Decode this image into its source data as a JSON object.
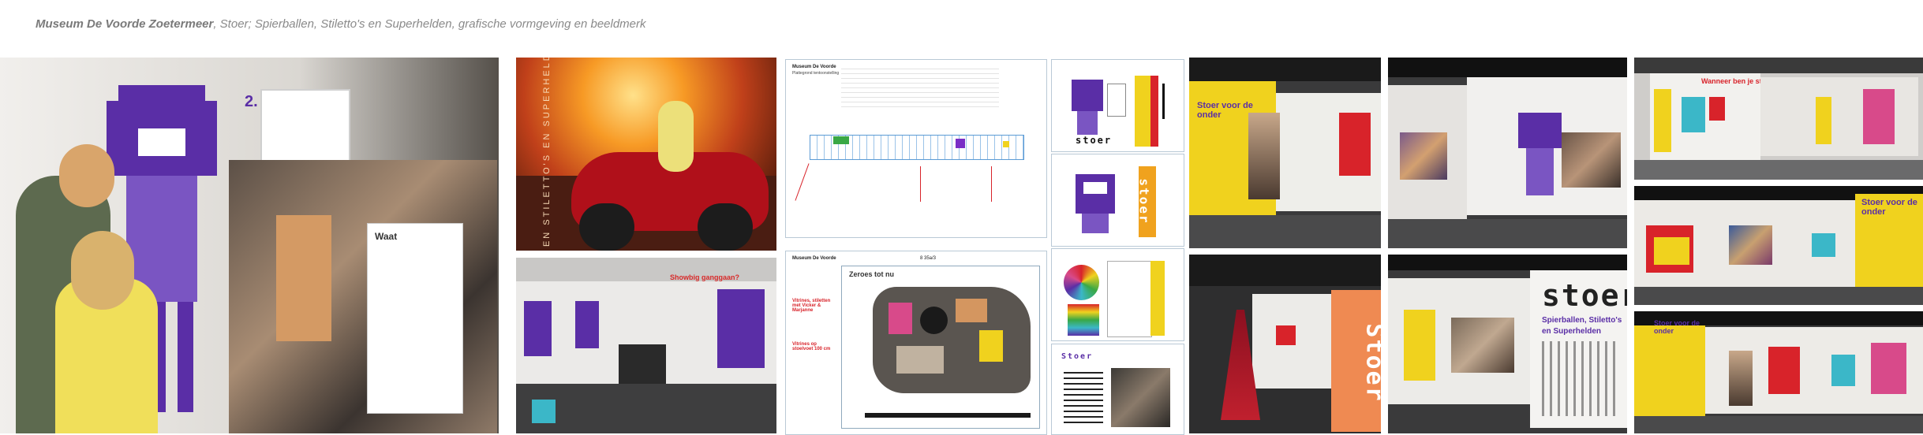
{
  "caption": {
    "museum": "Museum De Voorde Zoetermeer",
    "rest": ", Stoer; Spierballen, Stiletto's en Superhelden, grafische vormgeving en beeldmerk"
  },
  "photo1": {
    "wall_title": "Waat",
    "number": "2."
  },
  "photo2": {
    "vertical_text": "EN STILETTO'S EN SUPERHELDEN"
  },
  "plan1": {
    "title": "Museum De Voorde",
    "subtitle": "Plattegrond tentoonstelling"
  },
  "plan2": {
    "title": "Museum De Voorde",
    "heading": "Zeroes tot nu",
    "scale_label": "8  35a/3",
    "red_notes": [
      "Vitrines, stiletten met Vicker & Marjanne",
      "Vitrines op stoelvoet 100 cm"
    ]
  },
  "sheets": {
    "logo_word": "stoer",
    "vertical_word": "stoer",
    "sheet4_word": "Stoer"
  },
  "photo_mid": {
    "wall_text": "Stoer voor de onder"
  },
  "photo_right_top": {
    "wall_text": "Wanneer ben je stoer?"
  },
  "photo_right_mid": {
    "wall_text": "Stoer voor de onder"
  },
  "photo_right_bottom": {
    "wall_text": "Stoer voor de onder"
  },
  "photo_stoer": {
    "big_word": "stoer",
    "sub1": "Spierballen, Stiletto's",
    "sub2": "en Superhelden"
  },
  "photo_dress": {
    "tall_word": "Stoer"
  },
  "colors": {
    "purple": "#5a2ea6",
    "yellow": "#f2d21e",
    "red": "#d8232a",
    "gray_caption": "#8a8a8a"
  }
}
